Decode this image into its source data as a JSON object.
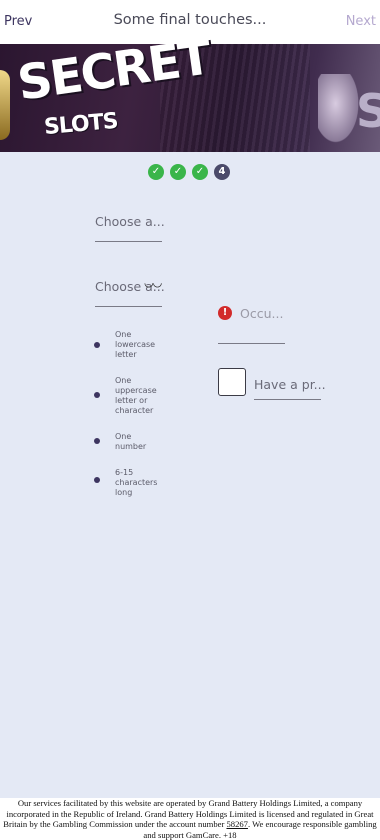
{
  "header": {
    "prev_label": "Prev",
    "title": "Some final touches...",
    "next_label": "Next"
  },
  "banner": {
    "logo_line1": "SECRET",
    "logo_line2": "SLOTS"
  },
  "steps": {
    "current_number": "4",
    "done_mark": "✓",
    "completed": 3,
    "total": 4
  },
  "form": {
    "field1_placeholder": "Choose a...",
    "field2_placeholder": "Choose a...",
    "eye_glyph": "◡◡",
    "occupation_placeholder": "Occu...",
    "promo_placeholder": "Have a pr...",
    "warn_glyph": "!"
  },
  "password_rules": [
    "One lowercase letter",
    "One uppercase letter or character",
    "One number",
    "6-15 characters long"
  ],
  "footer": {
    "text_part1": "Our services facilitated by this website are operated by Grand Battery Holdings Limited, a company incorporated in the Republic of Ireland. Grand Battery Holdings Limited is licensed and regulated in Great Britain by the Gambling Commission under the account number",
    "account_number": "58267",
    "text_part2": ". We encourage responsible gambling and support GamCare. +18"
  },
  "colors": {
    "background": "#e4e9f5",
    "step_done": "#3ab54a",
    "step_current": "#4b4a6a",
    "warning": "#d22b2b",
    "accent": "#3d3560"
  }
}
